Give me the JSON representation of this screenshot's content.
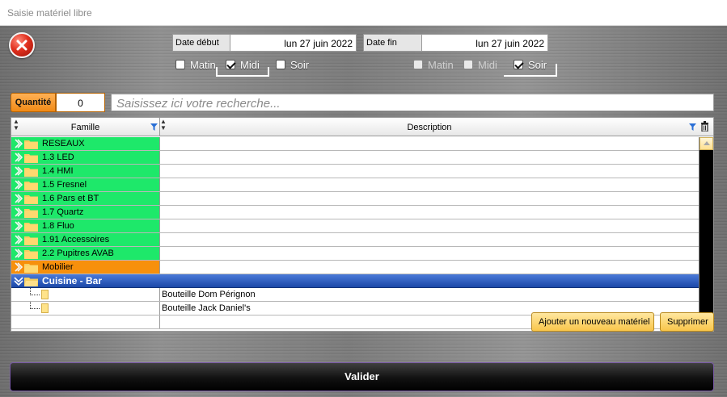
{
  "window": {
    "title": "Saisie matériel libre"
  },
  "dates": {
    "start_label": "Date début",
    "start_value": "lun 27 juin 2022",
    "end_label": "Date fin",
    "end_value": "lun 27 juin 2022"
  },
  "start_slots": [
    {
      "label": "Matin",
      "checked": false,
      "enabled": true
    },
    {
      "label": "Midi",
      "checked": true,
      "enabled": true
    },
    {
      "label": "Soir",
      "checked": false,
      "enabled": true
    }
  ],
  "end_slots": [
    {
      "label": "Matin",
      "checked": false,
      "enabled": false
    },
    {
      "label": "Midi",
      "checked": false,
      "enabled": false
    },
    {
      "label": "Soir",
      "checked": true,
      "enabled": true
    }
  ],
  "quantity": {
    "label": "Quantité",
    "value": "0"
  },
  "search": {
    "placeholder": "Saisissez ici votre recherche..."
  },
  "grid": {
    "columns": [
      "Famille",
      "Description"
    ],
    "groups": [
      {
        "name": "RESEAUX",
        "color": "green"
      },
      {
        "name": "1.3 LED",
        "color": "green"
      },
      {
        "name": "1.4 HMI",
        "color": "green"
      },
      {
        "name": "1.5 Fresnel",
        "color": "green"
      },
      {
        "name": "1.6 Pars et BT",
        "color": "green"
      },
      {
        "name": "1.7 Quartz",
        "color": "green"
      },
      {
        "name": "1.8 Fluo",
        "color": "green"
      },
      {
        "name": "1.91 Accessoires",
        "color": "green"
      },
      {
        "name": "2.2 Pupitres AVAB",
        "color": "green"
      },
      {
        "name": "Mobilier",
        "color": "orange"
      }
    ],
    "expanded_group": {
      "name": "Cuisine - Bar"
    },
    "items": [
      {
        "description": "Bouteille Dom Pérignon"
      },
      {
        "description": "Bouteille Jack Daniel's"
      }
    ]
  },
  "buttons": {
    "add_label": "Ajouter un nouveau matériel",
    "delete_label": "Supprimer",
    "validate_label": "Valider"
  },
  "colors": {
    "green": "#1ee86a",
    "orange": "#f7900c",
    "selected": "#2a5cc0",
    "accent_button": "#f9c64a"
  }
}
